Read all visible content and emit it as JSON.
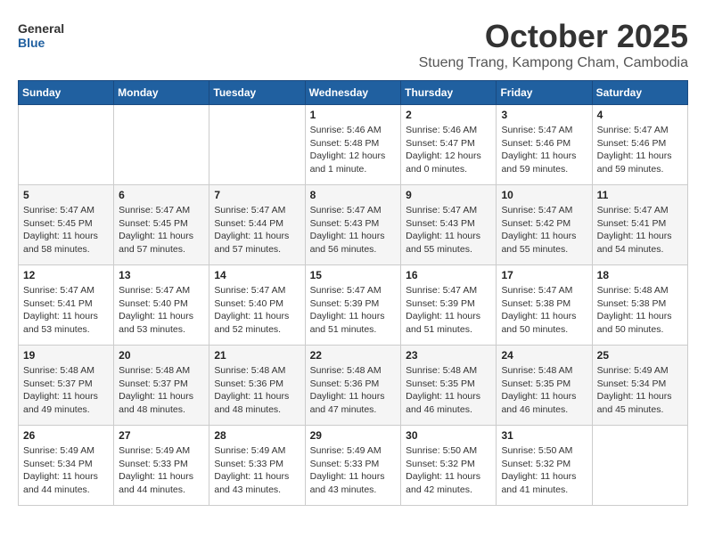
{
  "logo": {
    "line1": "General",
    "line2": "Blue"
  },
  "title": "October 2025",
  "location": "Stueng Trang, Kampong Cham, Cambodia",
  "days_of_week": [
    "Sunday",
    "Monday",
    "Tuesday",
    "Wednesday",
    "Thursday",
    "Friday",
    "Saturday"
  ],
  "weeks": [
    [
      {
        "day": "",
        "info": ""
      },
      {
        "day": "",
        "info": ""
      },
      {
        "day": "",
        "info": ""
      },
      {
        "day": "1",
        "info": "Sunrise: 5:46 AM\nSunset: 5:48 PM\nDaylight: 12 hours\nand 1 minute."
      },
      {
        "day": "2",
        "info": "Sunrise: 5:46 AM\nSunset: 5:47 PM\nDaylight: 12 hours\nand 0 minutes."
      },
      {
        "day": "3",
        "info": "Sunrise: 5:47 AM\nSunset: 5:46 PM\nDaylight: 11 hours\nand 59 minutes."
      },
      {
        "day": "4",
        "info": "Sunrise: 5:47 AM\nSunset: 5:46 PM\nDaylight: 11 hours\nand 59 minutes."
      }
    ],
    [
      {
        "day": "5",
        "info": "Sunrise: 5:47 AM\nSunset: 5:45 PM\nDaylight: 11 hours\nand 58 minutes."
      },
      {
        "day": "6",
        "info": "Sunrise: 5:47 AM\nSunset: 5:45 PM\nDaylight: 11 hours\nand 57 minutes."
      },
      {
        "day": "7",
        "info": "Sunrise: 5:47 AM\nSunset: 5:44 PM\nDaylight: 11 hours\nand 57 minutes."
      },
      {
        "day": "8",
        "info": "Sunrise: 5:47 AM\nSunset: 5:43 PM\nDaylight: 11 hours\nand 56 minutes."
      },
      {
        "day": "9",
        "info": "Sunrise: 5:47 AM\nSunset: 5:43 PM\nDaylight: 11 hours\nand 55 minutes."
      },
      {
        "day": "10",
        "info": "Sunrise: 5:47 AM\nSunset: 5:42 PM\nDaylight: 11 hours\nand 55 minutes."
      },
      {
        "day": "11",
        "info": "Sunrise: 5:47 AM\nSunset: 5:41 PM\nDaylight: 11 hours\nand 54 minutes."
      }
    ],
    [
      {
        "day": "12",
        "info": "Sunrise: 5:47 AM\nSunset: 5:41 PM\nDaylight: 11 hours\nand 53 minutes."
      },
      {
        "day": "13",
        "info": "Sunrise: 5:47 AM\nSunset: 5:40 PM\nDaylight: 11 hours\nand 53 minutes."
      },
      {
        "day": "14",
        "info": "Sunrise: 5:47 AM\nSunset: 5:40 PM\nDaylight: 11 hours\nand 52 minutes."
      },
      {
        "day": "15",
        "info": "Sunrise: 5:47 AM\nSunset: 5:39 PM\nDaylight: 11 hours\nand 51 minutes."
      },
      {
        "day": "16",
        "info": "Sunrise: 5:47 AM\nSunset: 5:39 PM\nDaylight: 11 hours\nand 51 minutes."
      },
      {
        "day": "17",
        "info": "Sunrise: 5:47 AM\nSunset: 5:38 PM\nDaylight: 11 hours\nand 50 minutes."
      },
      {
        "day": "18",
        "info": "Sunrise: 5:48 AM\nSunset: 5:38 PM\nDaylight: 11 hours\nand 50 minutes."
      }
    ],
    [
      {
        "day": "19",
        "info": "Sunrise: 5:48 AM\nSunset: 5:37 PM\nDaylight: 11 hours\nand 49 minutes."
      },
      {
        "day": "20",
        "info": "Sunrise: 5:48 AM\nSunset: 5:37 PM\nDaylight: 11 hours\nand 48 minutes."
      },
      {
        "day": "21",
        "info": "Sunrise: 5:48 AM\nSunset: 5:36 PM\nDaylight: 11 hours\nand 48 minutes."
      },
      {
        "day": "22",
        "info": "Sunrise: 5:48 AM\nSunset: 5:36 PM\nDaylight: 11 hours\nand 47 minutes."
      },
      {
        "day": "23",
        "info": "Sunrise: 5:48 AM\nSunset: 5:35 PM\nDaylight: 11 hours\nand 46 minutes."
      },
      {
        "day": "24",
        "info": "Sunrise: 5:48 AM\nSunset: 5:35 PM\nDaylight: 11 hours\nand 46 minutes."
      },
      {
        "day": "25",
        "info": "Sunrise: 5:49 AM\nSunset: 5:34 PM\nDaylight: 11 hours\nand 45 minutes."
      }
    ],
    [
      {
        "day": "26",
        "info": "Sunrise: 5:49 AM\nSunset: 5:34 PM\nDaylight: 11 hours\nand 44 minutes."
      },
      {
        "day": "27",
        "info": "Sunrise: 5:49 AM\nSunset: 5:33 PM\nDaylight: 11 hours\nand 44 minutes."
      },
      {
        "day": "28",
        "info": "Sunrise: 5:49 AM\nSunset: 5:33 PM\nDaylight: 11 hours\nand 43 minutes."
      },
      {
        "day": "29",
        "info": "Sunrise: 5:49 AM\nSunset: 5:33 PM\nDaylight: 11 hours\nand 43 minutes."
      },
      {
        "day": "30",
        "info": "Sunrise: 5:50 AM\nSunset: 5:32 PM\nDaylight: 11 hours\nand 42 minutes."
      },
      {
        "day": "31",
        "info": "Sunrise: 5:50 AM\nSunset: 5:32 PM\nDaylight: 11 hours\nand 41 minutes."
      },
      {
        "day": "",
        "info": ""
      }
    ]
  ]
}
